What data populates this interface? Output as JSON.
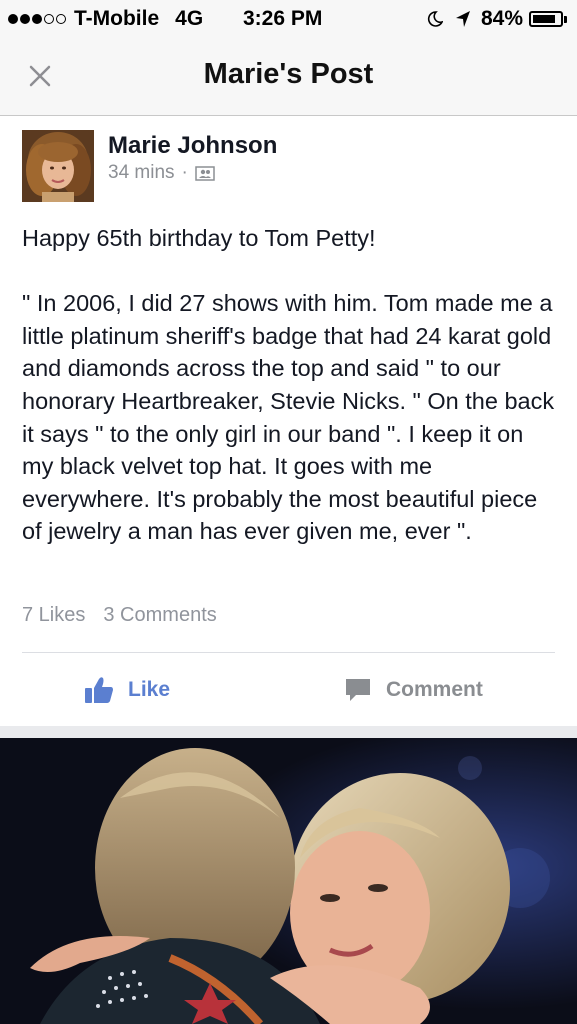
{
  "status_bar": {
    "carrier": "T-Mobile",
    "network": "4G",
    "time": "3:26 PM",
    "battery_text": "84%",
    "battery_level": 0.84,
    "signal_bars": 3,
    "signal_max": 5
  },
  "nav": {
    "title": "Marie's Post",
    "close_icon": "close-icon"
  },
  "post": {
    "author": "Marie Johnson",
    "time_ago": "34 mins",
    "separator": "·",
    "privacy_icon": "friends-icon",
    "body": "Happy 65th birthday to Tom Petty!\n\n\" In 2006, I did 27 shows with him. Tom made me a little platinum sheriff's badge that had 24 karat gold and diamonds across the top and said \" to our honorary Heartbreaker, Stevie Nicks. \" On the back it says \" to the only girl in our band \". I keep it on my black velvet top hat. It goes with me everywhere. It's probably the most beautiful piece of jewelry a man has ever given me, ever \".",
    "likes": "7 Likes",
    "comments": "3 Comments"
  },
  "actions": {
    "like_label": "Like",
    "comment_label": "Comment",
    "like_icon": "thumbs-up-icon",
    "comment_icon": "speech-bubble-icon"
  },
  "colors": {
    "like_blue": "#5b7fd0",
    "gray_text": "#90949c",
    "bar_bg": "#f7f7f7"
  }
}
